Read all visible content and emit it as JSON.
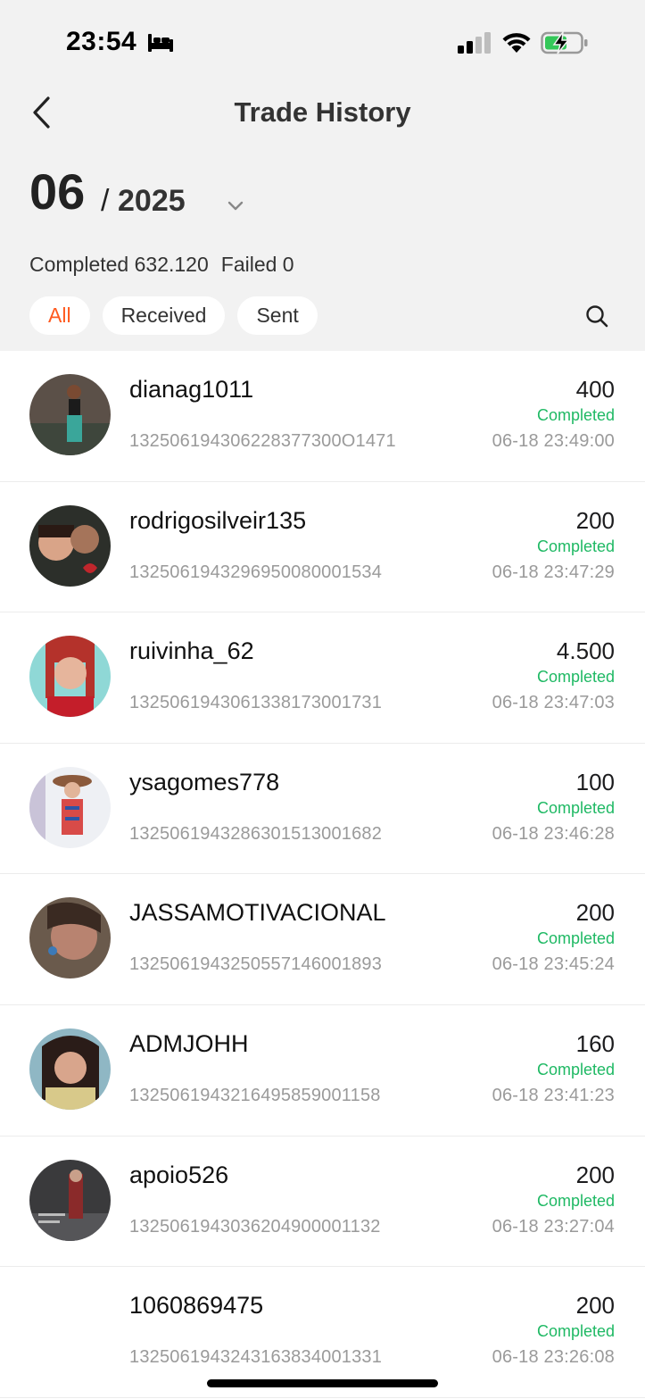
{
  "status_bar": {
    "time": "23:54",
    "icons": [
      "bed-icon",
      "signal-icon",
      "wifi-icon",
      "battery-charging-icon"
    ]
  },
  "header": {
    "title": "Trade History",
    "back_icon": "chevron-left-icon"
  },
  "month_picker": {
    "month": "06",
    "separator": "/",
    "year": "2025",
    "icon": "chevron-down-icon"
  },
  "summary": {
    "completed": "Completed 632.120",
    "failed": "Failed 0"
  },
  "filters": {
    "tabs": [
      {
        "label": "All",
        "active": true
      },
      {
        "label": "Received",
        "active": false
      },
      {
        "label": "Sent",
        "active": false
      }
    ],
    "search_icon": "search-icon"
  },
  "colors": {
    "active_tab": "#ff5a1f",
    "completed": "#1fb964",
    "header_bg": "#f2f2f2"
  },
  "transactions": [
    {
      "name": "dianag1011",
      "order": "132506194306228377300O1471",
      "amount": "400",
      "status": "Completed",
      "time": "06-18 23:49:00"
    },
    {
      "name": "rodrigosilveir135",
      "order": "1325061943296950080001534",
      "amount": "200",
      "status": "Completed",
      "time": "06-18 23:47:29"
    },
    {
      "name": "ruivinha_62",
      "order": "1325061943061338173001731",
      "amount": "4.500",
      "status": "Completed",
      "time": "06-18 23:47:03"
    },
    {
      "name": "ysagomes778",
      "order": "1325061943286301513001682",
      "amount": "100",
      "status": "Completed",
      "time": "06-18 23:46:28"
    },
    {
      "name": "JASSAMOTIVACIONAL",
      "order": "1325061943250557146001893",
      "amount": "200",
      "status": "Completed",
      "time": "06-18 23:45:24"
    },
    {
      "name": "ADMJOHH",
      "order": "1325061943216495859001158",
      "amount": "160",
      "status": "Completed",
      "time": "06-18 23:41:23"
    },
    {
      "name": "apoio526",
      "order": "1325061943036204900001132",
      "amount": "200",
      "status": "Completed",
      "time": "06-18 23:27:04"
    },
    {
      "name": "1060869475",
      "order": "1325061943243163834001331",
      "amount": "200",
      "status": "Completed",
      "time": "06-18 23:26:08"
    }
  ]
}
